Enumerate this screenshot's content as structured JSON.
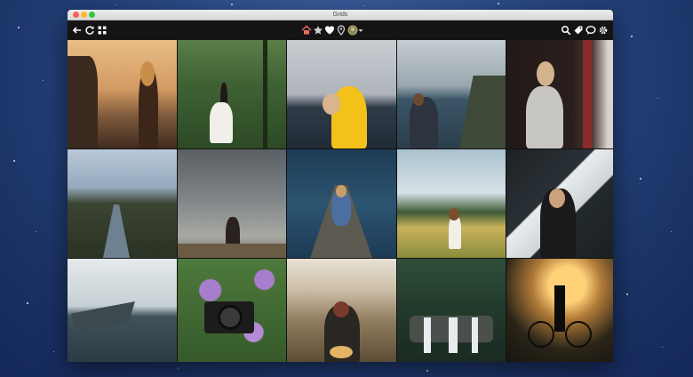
{
  "window": {
    "title": "Grids"
  },
  "toolbar": {
    "left_icons": [
      "back-arrow-icon",
      "refresh-icon",
      "grid-view-icon"
    ],
    "center_icons": [
      "home-icon",
      "star-icon",
      "heart-icon",
      "location-pin-icon",
      "profile-avatar-icon",
      "dropdown-caret-icon"
    ],
    "right_icons": [
      "search-icon",
      "tag-icon",
      "chat-bubble-icon",
      "gear-icon"
    ]
  },
  "grid": {
    "columns": 5,
    "rows": 3,
    "photos": [
      "woman-at-sunset-cliff",
      "woman-white-dress-forest",
      "yellow-raincoat-lake",
      "couple-embracing-coast",
      "man-by-window",
      "river-valley",
      "woman-storm-field",
      "woman-on-pier",
      "woman-green-meadow",
      "woman-shadow-portrait",
      "rowboat-on-water",
      "camera-among-flowers",
      "person-in-dry-grass",
      "forest-waterfall",
      "cyclist-silhouette"
    ]
  }
}
